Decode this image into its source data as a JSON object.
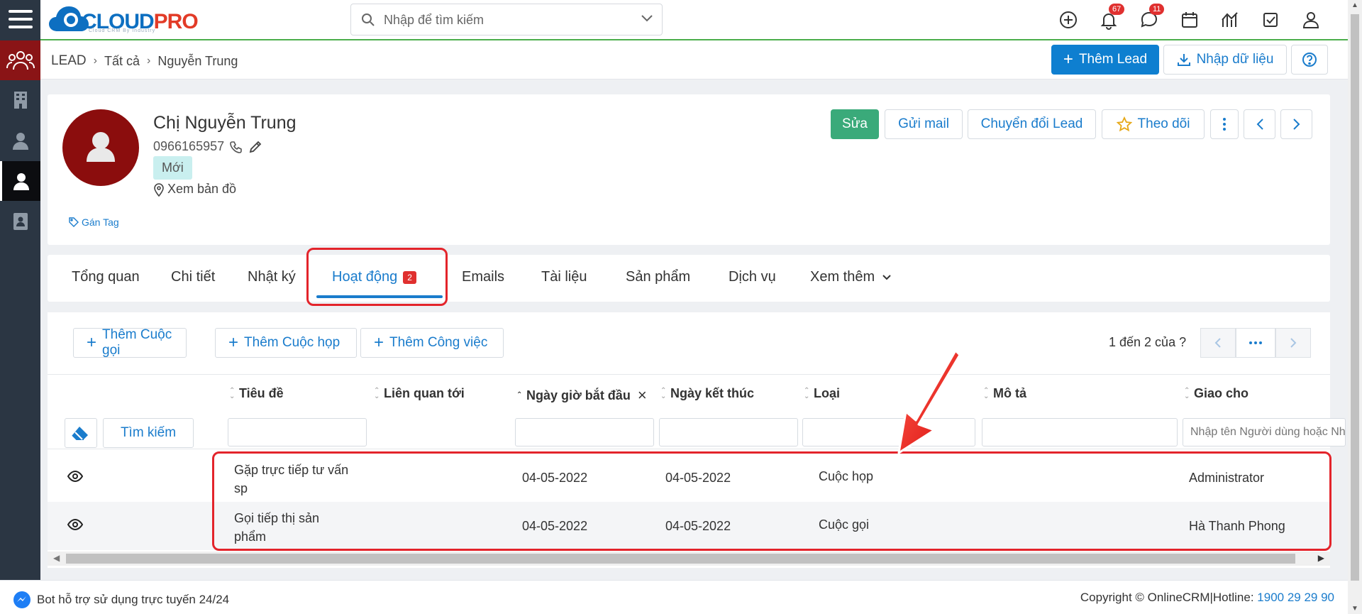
{
  "logo": {
    "brand_a": "CLOUD",
    "brand_b": "PRO",
    "tagline": "Cloud CRM By Industry"
  },
  "search": {
    "placeholder": "Nhập để tìm kiếm"
  },
  "topbar": {
    "notifications_count": "67",
    "messages_count": "11"
  },
  "breadcrumb": {
    "module": "LEAD",
    "level1": "Tất cả",
    "level2": "Nguyễn Trung"
  },
  "header_actions": {
    "add_lead": "Thêm Lead",
    "import": "Nhập dữ liệu"
  },
  "profile": {
    "name": "Chị Nguyễn Trung",
    "phone": "0966165957",
    "status": "Mới",
    "map_link": "Xem bản đồ",
    "tag_link": "Gán Tag"
  },
  "profile_actions": {
    "edit": "Sửa",
    "send_mail": "Gửi mail",
    "convert": "Chuyển đổi Lead",
    "follow": "Theo dõi"
  },
  "tabs": [
    {
      "label": "Tổng quan"
    },
    {
      "label": "Chi tiết"
    },
    {
      "label": "Nhật ký"
    },
    {
      "label": "Hoạt động",
      "count": "2"
    },
    {
      "label": "Emails"
    },
    {
      "label": "Tài liệu"
    },
    {
      "label": "Sản phẩm"
    },
    {
      "label": "Dịch vụ"
    },
    {
      "label": "Xem thêm"
    }
  ],
  "activity": {
    "add_call": "Thêm Cuộc gọi",
    "add_meeting": "Thêm Cuộc họp",
    "add_task": "Thêm Công việc",
    "pager_text": "1 đến 2 của",
    "pager_help": "?",
    "search_button": "Tìm kiếm",
    "assignee_placeholder": "Nhập tên Người dùng hoặc Nhóm",
    "columns": [
      "Tiêu đề",
      "Liên quan tới",
      "Ngày giờ bắt đầu",
      "Ngày kết thúc",
      "Loại",
      "Mô tả",
      "Giao cho"
    ],
    "rows": [
      {
        "title_l1": "Gặp trực tiếp tư vấn",
        "title_l2": "sp",
        "start": "04-05-2022",
        "end": "04-05-2022",
        "type": "Cuộc họp",
        "assignee": "Administrator"
      },
      {
        "title_l1": "Gọi tiếp thị sản",
        "title_l2": "phẩm",
        "start": "04-05-2022",
        "end": "04-05-2022",
        "type": "Cuộc gọi",
        "assignee": "Hà Thanh Phong"
      }
    ]
  },
  "footer": {
    "bot_text": "Bot hỗ trợ sử dụng trực tuyến 24/24",
    "copyright": "Copyright © OnlineCRM|Hotline: ",
    "hotline": "1900 29 29 90"
  },
  "colors": {
    "accent": "#1a7ccc",
    "primary_button": "#0e7fd0",
    "edit_button": "#3aaa7a",
    "highlight": "#e3242b",
    "rail": "#2b3643",
    "avatar": "#8b0d0d"
  }
}
